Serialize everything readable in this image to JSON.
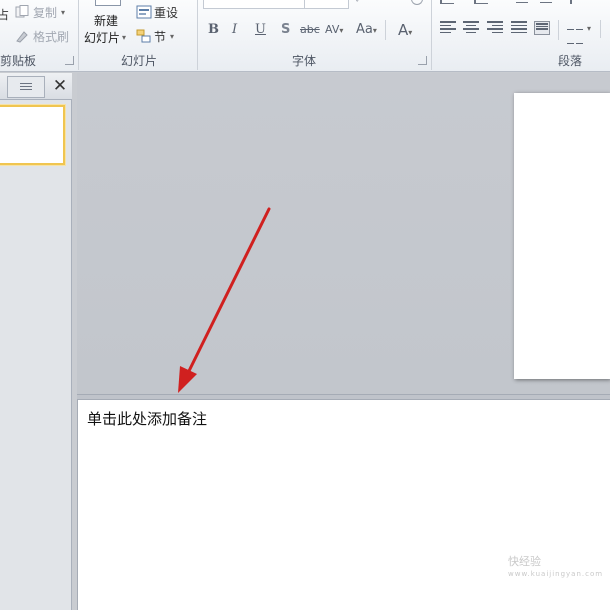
{
  "ribbon": {
    "clipboard": {
      "copy_label": "复制",
      "format_painter_label": "格式刷",
      "group_label_visible": "剪贴板",
      "paste_fragment": "占"
    },
    "slides": {
      "new_slide_line1": "新建",
      "new_slide_line2": "幻灯片",
      "reset_label": "重设",
      "section_label": "节",
      "group_label": "幻灯片"
    },
    "font": {
      "group_label": "字体",
      "bold": "B",
      "italic": "I",
      "underline": "U",
      "strikethrough": "S",
      "abc_label": "abc",
      "char_spacing": "AV",
      "change_case": "Aa",
      "font_color": "A"
    },
    "paragraph": {
      "group_label": "段落"
    }
  },
  "notes": {
    "placeholder": "单击此处添加备注"
  },
  "watermark": {
    "line1": "快经验",
    "line2": "www.kuaijingyan.com"
  },
  "colors": {
    "arrow": "#d0201f",
    "thumb_selected_border": "#f0c550"
  }
}
